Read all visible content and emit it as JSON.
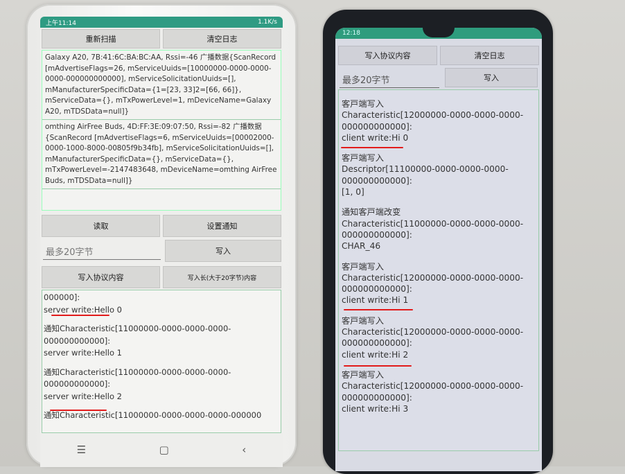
{
  "left_phone": {
    "status_time": "上午11:14",
    "status_net": "1.1K/s",
    "buttons": {
      "rescan": "重新扫描",
      "clear_log": "清空日志",
      "read": "读取",
      "set_notify": "设置通知",
      "write": "写入",
      "write_protocol": "写入协议内容",
      "write_long": "写入长(大于20字节)内容"
    },
    "input_placeholder": "最多20字节",
    "scan_results": [
      "Galaxy A20, 7B:41:6C:BA:BC:AA, Rssi=-46 广播数据{ScanRecord [mAdvertiseFlags=26, mServiceUuids=[10000000-0000-0000-0000-000000000000], mServiceSolicitationUuids=[], mManufacturerSpecificData={1=[23, 33]2=[66, 66]}, mServiceData={}, mTxPowerLevel=1, mDeviceName=Galaxy A20, mTDSData=null]}",
      "omthing AirFree Buds, 4D:FF:3E:09:07:50, Rssi=-82 广播数据{ScanRecord [mAdvertiseFlags=6, mServiceUuids=[00002000-0000-1000-8000-00805f9b34fb], mServiceSolicitationUuids=[], mManufacturerSpecificData={}, mServiceData={}, mTxPowerLevel=-2147483648, mDeviceName=omthing AirFree Buds, mTDSData=null]}"
    ],
    "log": [
      {
        "head": "000000]:",
        "body": "server write:Hello 0"
      },
      {
        "head": "通知Characteristic[11000000-0000-0000-0000-000000000000]:",
        "body": "server write:Hello 1"
      },
      {
        "head": "通知Characteristic[11000000-0000-0000-0000-000000000000]:",
        "body": "server write:Hello 2"
      },
      {
        "head": "通知Characteristic[11000000-0000-0000-0000-000000",
        "body": ""
      }
    ],
    "nav": {
      "menu": "☰",
      "home": "▢",
      "back": "‹"
    }
  },
  "right_phone": {
    "status_time": "12:18",
    "buttons": {
      "write_protocol": "写入协议内容",
      "clear_log": "清空日志",
      "write": "写入"
    },
    "input_placeholder": "最多20字节",
    "log": [
      {
        "head": "客戸端写入",
        "line2": "Characteristic[12000000-0000-0000-0000-000000000000]:",
        "body": "client write:Hi 0"
      },
      {
        "head": "客戸端写入",
        "line2": "Descriptor[11100000-0000-0000-0000-000000000000]:",
        "body": "[1, 0]"
      },
      {
        "head": "通知客戸端改变",
        "line2": "Characteristic[11000000-0000-0000-0000-000000000000]:",
        "body": "CHAR_46"
      },
      {
        "head": "客戸端写入",
        "line2": "Characteristic[12000000-0000-0000-0000-000000000000]:",
        "body": "client write:Hi 1"
      },
      {
        "head": "客戸端写入",
        "line2": "Characteristic[12000000-0000-0000-0000-000000000000]:",
        "body": "client write:Hi 2"
      },
      {
        "head": "客戸端写入",
        "line2": "Characteristic[12000000-0000-0000-0000-000000000000]:",
        "body": "client write:Hi 3"
      }
    ]
  },
  "colors": {
    "underline": "#e21b1b",
    "status_bar": "#2f9b83"
  }
}
